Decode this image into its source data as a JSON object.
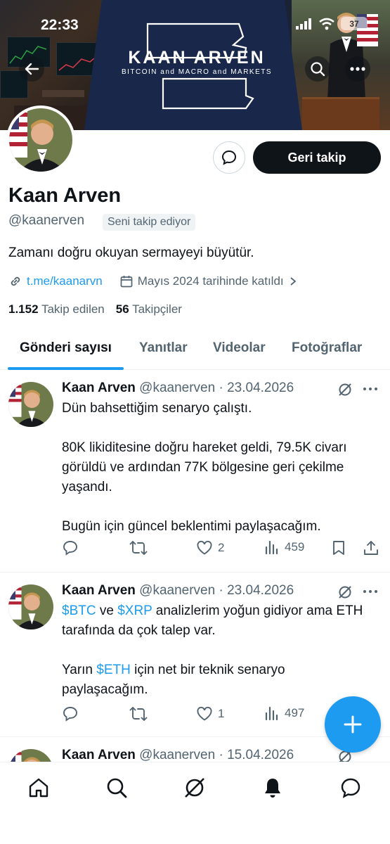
{
  "status_bar": {
    "time": "22:33",
    "battery": "37"
  },
  "banner": {
    "brand": "KAAN ARVEN",
    "tagline": "BITCOIN and MACRO and MARKETS"
  },
  "profile": {
    "name": "Kaan Arven",
    "handle": "@kaanerven",
    "follows_you": "Seni takip ediyor",
    "follow_back": "Geri takip",
    "bio": "Zamanı doğru okuyan sermayeyi büyütür.",
    "link": "t.me/kaanarvn",
    "joined": "Mayıs 2024 tarihinde katıldı",
    "following_count": "1.152",
    "following_label": "Takip edilen",
    "followers_count": "56",
    "followers_label": "Takipçiler"
  },
  "tabs": [
    {
      "label": "Gönderi sayısı"
    },
    {
      "label": "Yanıtlar"
    },
    {
      "label": "Videolar"
    },
    {
      "label": "Fotoğraflar"
    }
  ],
  "tweets": [
    {
      "name": "Kaan Arven",
      "handle": "@kaanerven",
      "date": "· 23.04.2026",
      "lines": [
        "Dün bahsettiğim senaryo çalıştı.",
        "80K likiditesine doğru hareket geldi, 79.5K civarı görüldü ve ardından 77K bölgesine geri çekilme yaşandı.",
        "Bugün için güncel beklentimi paylaşacağım."
      ],
      "likes": "2",
      "views": "459"
    },
    {
      "name": "Kaan Arven",
      "handle": "@kaanerven",
      "date": "· 23.04.2026",
      "p1_cash1": "$BTC",
      "p1_t1": " ve ",
      "p1_cash2": "$XRP",
      "p1_t2": " analizlerim yoğun gidiyor ama ETH tarafında da çok talep var.",
      "p2_t1": "Yarın ",
      "p2_cash": "$ETH",
      "p2_t2": " için net bir teknik senaryo paylaşacağım.",
      "likes": "1",
      "views": "497"
    },
    {
      "name": "Kaan Arven",
      "handle": "@kaanerven",
      "date": "· 15.04.2026"
    }
  ],
  "icons": {
    "back": "arrow-left-icon",
    "search": "search-icon",
    "more": "more-icon",
    "message": "message-icon",
    "link": "link-icon",
    "calendar": "calendar-icon",
    "reply": "reply-icon",
    "retweet": "retweet-icon",
    "like": "heart-icon",
    "views": "views-icon",
    "bookmark": "bookmark-icon",
    "share": "share-icon",
    "grok": "grok-icon",
    "compose": "plus-icon",
    "home": "home-icon",
    "explore": "search-icon",
    "notifications": "bell-icon",
    "messages": "message-icon"
  },
  "colors": {
    "accent": "#1d9bf0",
    "text": "#0f1419",
    "muted": "#536471",
    "banner_navy": "#19284a"
  }
}
